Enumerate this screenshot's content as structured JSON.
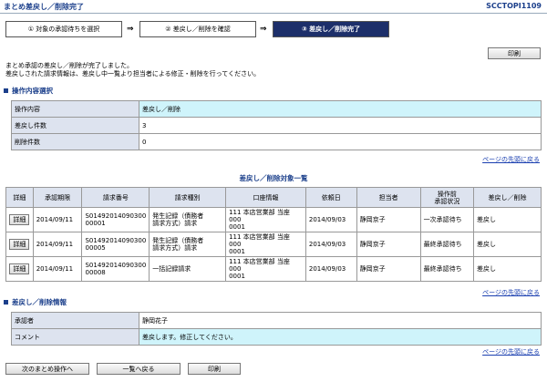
{
  "header": {
    "title": "まとめ差戻し／削除完了",
    "screen_id": "SCCTOPI1109"
  },
  "steps": [
    {
      "label": "① 対象の承認待ちを選択"
    },
    {
      "label": "② 差戻し／削除を確認"
    },
    {
      "label": "③ 差戻し／削除完了"
    }
  ],
  "arrow": "⇒",
  "print_label": "印刷",
  "message": {
    "line1": "まとめ承認の差戻し／削除が完了しました。",
    "line2": "差戻しされた請求情報は、差戻し中一覧より担当者による修正・削除を行ってください。"
  },
  "op_section": {
    "title": "操作内容選択",
    "rows": [
      {
        "label": "操作内容",
        "value": "差戻し／削除"
      },
      {
        "label": "差戻し件数",
        "value": "3"
      },
      {
        "label": "削除件数",
        "value": "0"
      }
    ]
  },
  "page_top_link": "ページの先頭に戻る",
  "list": {
    "title": "差戻し／削除対象一覧",
    "headers": [
      "詳細",
      "承認期限",
      "請求番号",
      "請求種別",
      "口座情報",
      "依頼日",
      "担当者",
      "操作前\n承認状況",
      "差戻し／削除"
    ],
    "detail_label": "詳細",
    "rows": [
      {
        "deadline": "2014/09/11",
        "number": "S01492014090300\n00001",
        "type": "発生記録（債務者\n請求方式）請求",
        "account": "111 本店営業部 当座 000\n0001",
        "date": "2014/09/03",
        "person": "静岡京子",
        "status": "一次承認待ち",
        "action": "差戻し"
      },
      {
        "deadline": "2014/09/11",
        "number": "S01492014090300\n00005",
        "type": "発生記録（債務者\n請求方式）請求",
        "account": "111 本店営業部 当座 000\n0001",
        "date": "2014/09/03",
        "person": "静岡京子",
        "status": "最終承認待ち",
        "action": "差戻し"
      },
      {
        "deadline": "2014/09/11",
        "number": "S01492014090300\n00008",
        "type": "一括記録請求",
        "account": "111 本店営業部 当座 000\n0001",
        "date": "2014/09/03",
        "person": "静岡京子",
        "status": "最終承認待ち",
        "action": "差戻し"
      }
    ]
  },
  "info_section": {
    "title": "差戻し／削除情報",
    "rows": [
      {
        "label": "承認者",
        "value": "静岡花子"
      },
      {
        "label": "コメント",
        "value": "差戻します。修正してください。"
      }
    ]
  },
  "footer": {
    "next_label": "次のまとめ操作へ",
    "back_label": "一覧へ戻る",
    "print_label": "印刷"
  }
}
